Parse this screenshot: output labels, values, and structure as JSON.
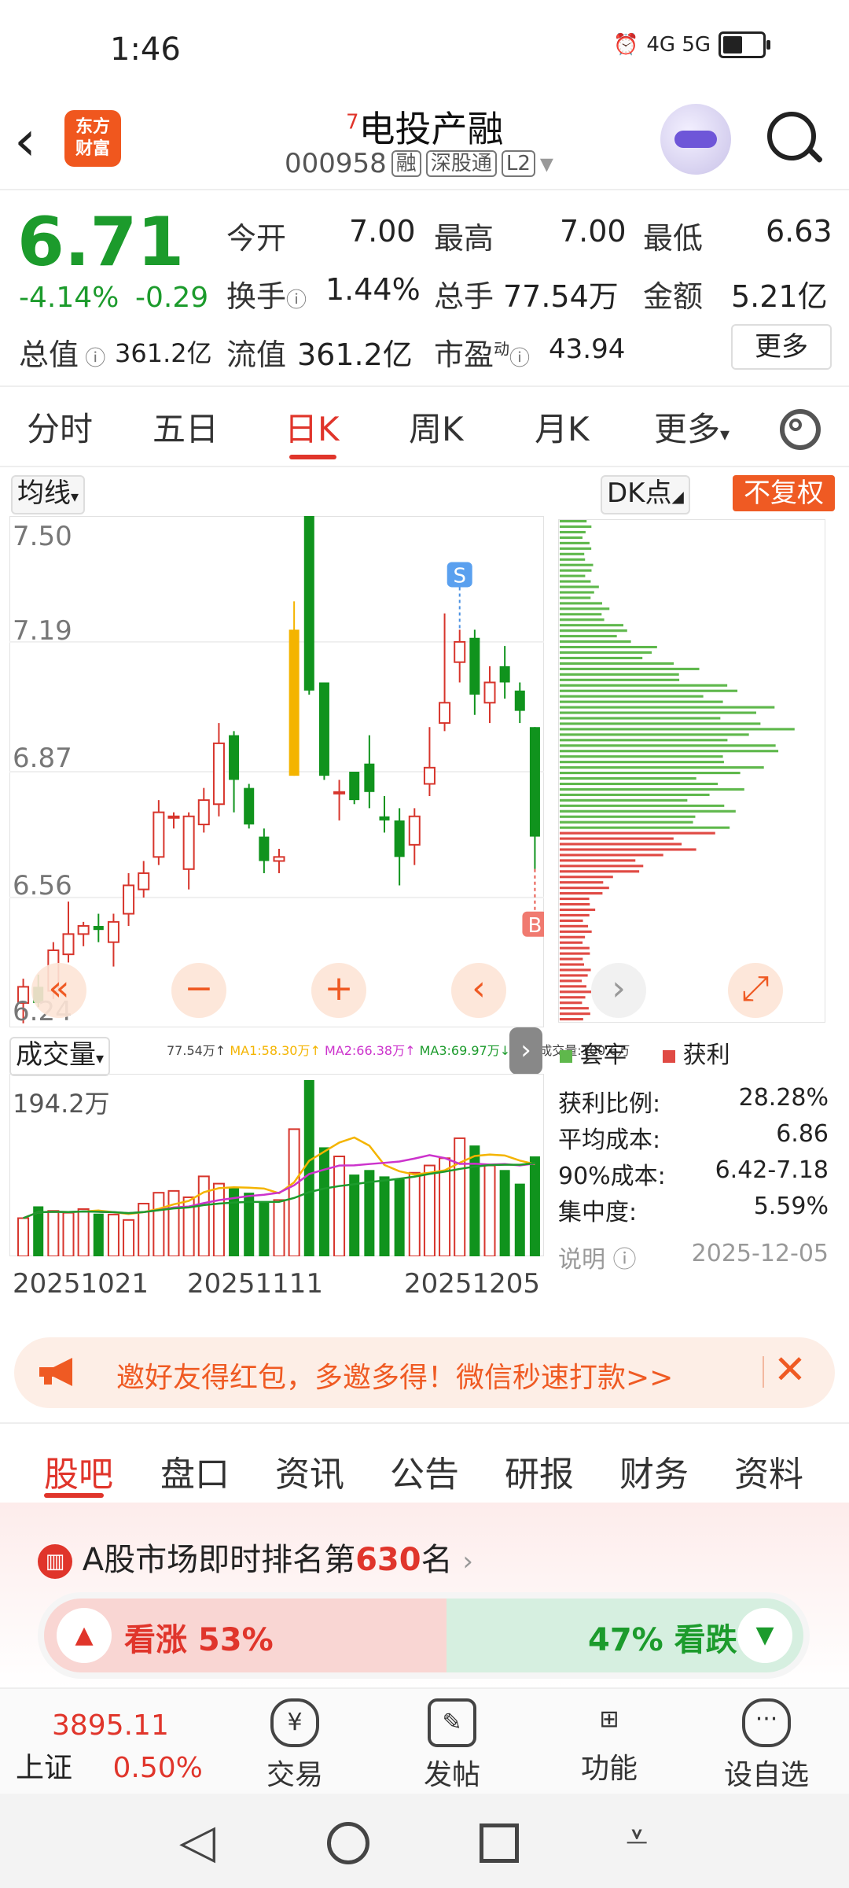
{
  "status_bar": {
    "time": "1:46",
    "network": "4G 5G"
  },
  "header": {
    "logo": "东方\n财富",
    "stock_name": "电投产融",
    "stock_name_sup": "7",
    "code": "000958",
    "tags": [
      "融",
      "深股通",
      "L2"
    ]
  },
  "quote": {
    "price": "6.71",
    "change_pct": "-4.14%",
    "change": "-0.29",
    "total_value_label": "总值",
    "total_value": "361.2亿",
    "rows": [
      [
        {
          "label": "今开",
          "value": "7.00"
        },
        {
          "label": "最高",
          "value": "7.00"
        },
        {
          "label": "最低",
          "value": "6.63"
        }
      ],
      [
        {
          "label": "换手",
          "value": "1.44%"
        },
        {
          "label": "总手",
          "value": "77.54万"
        },
        {
          "label": "金额",
          "value": "5.21亿"
        }
      ],
      [
        {
          "label": "流值",
          "value": "361.2亿"
        },
        {
          "label": "市盈",
          "value": "43.94",
          "sup": "动"
        }
      ]
    ],
    "more": "更多"
  },
  "period_tabs": {
    "items": [
      "分时",
      "五日",
      "日K",
      "周K",
      "月K",
      "更多"
    ],
    "active": "日K"
  },
  "chart_controls": {
    "ma": "均线",
    "dk": "DK点",
    "fuquan": "不复权",
    "volume": "成交量"
  },
  "chart_data": {
    "type": "candlestick",
    "y_ticks": [
      "7.50",
      "7.19",
      "6.87",
      "6.56",
      "6.24"
    ],
    "ylim": [
      6.24,
      7.5
    ],
    "x_labels": [
      "20251021",
      "20251111",
      "20251205"
    ],
    "candles": [
      {
        "o": 6.3,
        "h": 6.36,
        "l": 6.25,
        "c": 6.34
      },
      {
        "o": 6.34,
        "h": 6.37,
        "l": 6.29,
        "c": 6.3
      },
      {
        "o": 6.33,
        "h": 6.45,
        "l": 6.31,
        "c": 6.43
      },
      {
        "o": 6.42,
        "h": 6.55,
        "l": 6.4,
        "c": 6.47
      },
      {
        "o": 6.47,
        "h": 6.5,
        "l": 6.44,
        "c": 6.49
      },
      {
        "o": 6.49,
        "h": 6.52,
        "l": 6.45,
        "c": 6.48
      },
      {
        "o": 6.45,
        "h": 6.52,
        "l": 6.39,
        "c": 6.5
      },
      {
        "o": 6.52,
        "h": 6.62,
        "l": 6.49,
        "c": 6.59
      },
      {
        "o": 6.58,
        "h": 6.65,
        "l": 6.56,
        "c": 6.62
      },
      {
        "o": 6.66,
        "h": 6.8,
        "l": 6.64,
        "c": 6.77
      },
      {
        "o": 6.76,
        "h": 6.77,
        "l": 6.73,
        "c": 6.76
      },
      {
        "o": 6.63,
        "h": 6.77,
        "l": 6.58,
        "c": 6.76
      },
      {
        "o": 6.74,
        "h": 6.83,
        "l": 6.72,
        "c": 6.8
      },
      {
        "o": 6.79,
        "h": 6.99,
        "l": 6.76,
        "c": 6.94
      },
      {
        "o": 6.96,
        "h": 6.97,
        "l": 6.77,
        "c": 6.85
      },
      {
        "o": 6.83,
        "h": 6.84,
        "l": 6.73,
        "c": 6.74
      },
      {
        "o": 6.71,
        "h": 6.73,
        "l": 6.62,
        "c": 6.65
      },
      {
        "o": 6.65,
        "h": 6.68,
        "l": 6.62,
        "c": 6.66
      },
      {
        "o": 6.86,
        "h": 7.29,
        "l": 6.86,
        "c": 7.22
      },
      {
        "o": 7.52,
        "h": 7.52,
        "l": 7.06,
        "c": 7.07
      },
      {
        "o": 7.09,
        "h": 7.09,
        "l": 6.85,
        "c": 6.86
      },
      {
        "o": 6.82,
        "h": 6.85,
        "l": 6.75,
        "c": 6.82
      },
      {
        "o": 6.87,
        "h": 6.87,
        "l": 6.79,
        "c": 6.8
      },
      {
        "o": 6.89,
        "h": 6.96,
        "l": 6.78,
        "c": 6.82
      },
      {
        "o": 6.76,
        "h": 6.81,
        "l": 6.72,
        "c": 6.75
      },
      {
        "o": 6.75,
        "h": 6.78,
        "l": 6.59,
        "c": 6.66
      },
      {
        "o": 6.69,
        "h": 6.78,
        "l": 6.64,
        "c": 6.76
      },
      {
        "o": 6.84,
        "h": 6.98,
        "l": 6.81,
        "c": 6.88
      },
      {
        "o": 6.99,
        "h": 7.26,
        "l": 6.97,
        "c": 7.04
      },
      {
        "o": 7.14,
        "h": 7.22,
        "l": 7.09,
        "c": 7.19
      },
      {
        "o": 7.2,
        "h": 7.22,
        "l": 7.01,
        "c": 7.06
      },
      {
        "o": 7.04,
        "h": 7.13,
        "l": 6.99,
        "c": 7.09
      },
      {
        "o": 7.13,
        "h": 7.18,
        "l": 7.05,
        "c": 7.09
      },
      {
        "o": 7.07,
        "h": 7.09,
        "l": 6.99,
        "c": 7.02
      },
      {
        "o": 6.98,
        "h": 6.98,
        "l": 6.63,
        "c": 6.71
      }
    ],
    "markers": [
      {
        "label": "S",
        "index": 29
      },
      {
        "label": "B",
        "index": 34
      }
    ],
    "volume_max_label": "194.2万",
    "volume_legend": [
      "77.54万↑",
      "MA1:58.30万↑",
      "MA2:66.38万↑",
      "MA3:69.97万↓",
      "虚拟成交量:100.6万"
    ],
    "volume": [
      42,
      55,
      50,
      48,
      52,
      47,
      46,
      40,
      58,
      70,
      72,
      65,
      88,
      80,
      75,
      70,
      60,
      62,
      140,
      194,
      120,
      110,
      90,
      95,
      88,
      85,
      92,
      100,
      108,
      130,
      122,
      100,
      95,
      80,
      110
    ],
    "ma_colors": [
      "#f4b400",
      "#cc33cc",
      "#1c9b2c"
    ],
    "up_color": "#d7352c",
    "down_color": "#10931d",
    "limit_up_color": "#f4b400"
  },
  "distribution": {
    "legend": [
      "套牢",
      "获利"
    ],
    "stats": [
      {
        "label": "获利比例:",
        "value": "28.28%"
      },
      {
        "label": "平均成本:",
        "value": "6.86"
      },
      {
        "label": "90%成本:",
        "value": "6.42-7.18"
      },
      {
        "label": "集中度:",
        "value": "5.59%"
      }
    ],
    "note_label": "说明",
    "date": "2025-12-05"
  },
  "banner": {
    "text": "邀好友得红包，多邀多得！微信秒速打款>>"
  },
  "bottom_tabs": {
    "items": [
      "股吧",
      "盘口",
      "资讯",
      "公告",
      "研报",
      "财务",
      "资料"
    ],
    "active": "股吧"
  },
  "rank": {
    "prefix": "A股市场即时排名第",
    "number": "630",
    "suffix": "名"
  },
  "sentiment": {
    "up_label": "看涨 53%",
    "down_label": "47% 看跌"
  },
  "bottom_nav": {
    "index_value": "3895.11",
    "index_name": "上证",
    "index_change": "0.50%",
    "items": [
      "交易",
      "发帖",
      "功能",
      "设自选"
    ]
  }
}
